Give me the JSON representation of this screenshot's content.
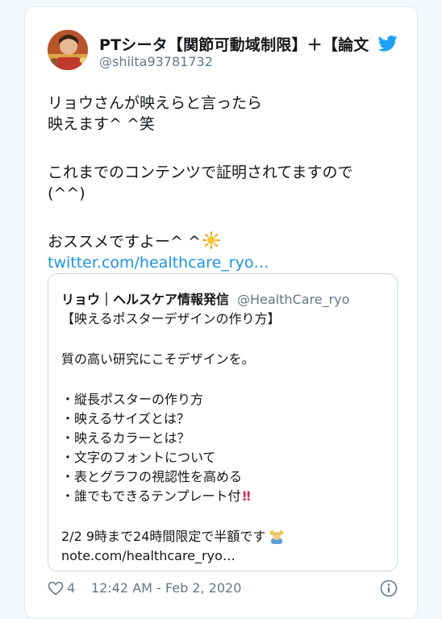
{
  "author": {
    "display_name": "PTシータ【関節可動域制限】＋【論文",
    "handle": "@shiita93781732",
    "avatar_icon": "avatar-photo",
    "platform_icon": "twitter-bird-icon"
  },
  "tweet": {
    "lines": [
      "リョウさんが映えらと言ったら",
      "映えます^ ^笑",
      "これまでのコンテンツで証明されてますので",
      "(^^)",
      "おススメですよー^ ^"
    ],
    "sun_icon": "sun-emoji-icon",
    "link": "twitter.com/healthcare_ryo…"
  },
  "quoted_tweet": {
    "name": "リョウ｜ヘルスケア情報発信",
    "handle": "@HealthCare_ryo",
    "lines": [
      "【映えるポスターデザインの作り方】",
      "質の高い研究にこそデザインを。",
      "・縦長ポスターの作り方",
      "・映えるサイズとは？",
      "・映えるカラーとは？",
      "・文字のフォントについて",
      "・表とグラフの視認性を高める",
      "・誰でもできるテンプレート付",
      "2/2  9時まで24時間限定で半額です",
      "note.com/healthcare_ryo…"
    ],
    "bangbang_glyph": "‼",
    "person_icon": "person-gesturing-ok-emoji-icon"
  },
  "footer": {
    "like_count": "4",
    "timestamp": "12:42 AM - Feb 2, 2020",
    "info_icon": "info-icon"
  },
  "colors": {
    "link": "#1b95e0",
    "secondary_text": "#657786",
    "primary_text": "#14171a",
    "twitter_blue": "#1da1f2",
    "border": "#e1e8ed",
    "background": "#f5f8fa"
  }
}
